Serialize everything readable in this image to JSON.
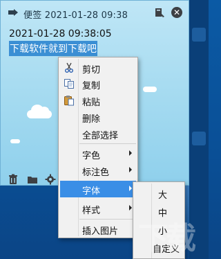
{
  "note": {
    "title": "便签 2021-01-28 09:38",
    "body_line1": "2021-01-28 09:38:05",
    "body_line2_selected": "下载软件就到下载吧"
  },
  "icons": {
    "app": "sticky-note-icon",
    "pin": "pin-icon",
    "close": "close-icon",
    "delete": "trash-icon",
    "folder": "folder-icon",
    "settings": "gear-icon"
  },
  "context_menu": {
    "items": [
      {
        "label": "剪切",
        "icon": "scissors-icon"
      },
      {
        "label": "复制",
        "icon": "copy-icon"
      },
      {
        "label": "粘贴",
        "icon": "paste-icon"
      },
      {
        "label": "删除"
      },
      {
        "label": "全部选择"
      },
      {
        "label": "字色",
        "submenu": true
      },
      {
        "label": "标注色",
        "submenu": true
      },
      {
        "label": "字体",
        "submenu": true,
        "highlighted": true
      },
      {
        "label": "样式",
        "submenu": true
      },
      {
        "label": "插入图片"
      }
    ]
  },
  "font_submenu": {
    "items": [
      {
        "label": "大"
      },
      {
        "label": "中"
      },
      {
        "label": "小"
      },
      {
        "label": "自定义"
      }
    ]
  },
  "colors": {
    "note_bg": "#a8dcf1",
    "selection": "#3b8fd4",
    "menu_highlight": "#3a8ee6",
    "desktop": "#0b5aa5"
  }
}
